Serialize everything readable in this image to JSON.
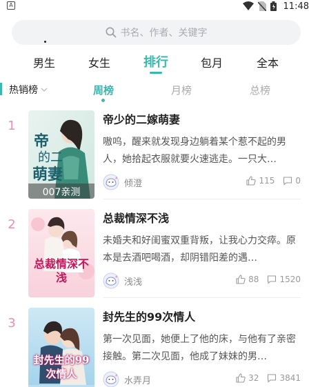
{
  "status": {
    "time": "11:48",
    "app_letter": "A"
  },
  "search": {
    "placeholder": "书名、作者、关键字"
  },
  "top_tabs": [
    {
      "label": "男生"
    },
    {
      "label": "女生"
    },
    {
      "label": "排行"
    },
    {
      "label": "包月"
    },
    {
      "label": "全本"
    }
  ],
  "active_top_tab": "排行",
  "sub": {
    "filter_label": "热销榜",
    "tabs": [
      {
        "label": "周榜"
      },
      {
        "label": "月榜"
      },
      {
        "label": "总榜"
      }
    ]
  },
  "accent_color": "#38b8ae",
  "rank_color": "#e88fb2",
  "books": [
    {
      "rank": "1",
      "title": "帝少的二嫁萌妻",
      "desc": "嗷呜，醒来就发现身边躺着某个惹不起的男人，她拾起衣服就要火速逃走。一只大…",
      "author": "倾澄",
      "likes": "115",
      "comments": "0",
      "cover_text": "007亲测"
    },
    {
      "rank": "2",
      "title": "总裁情深不浅",
      "desc": "未婚夫和好闺蜜双重背叛，让我心力交瘁。原本是去酒吧喝酒，却阴错阳差的遇…",
      "author": "浅浅",
      "likes": "88",
      "comments": "1520",
      "cover_text": "总裁情深不浅"
    },
    {
      "rank": "3",
      "title": "封先生的99次情人",
      "desc": "第一次见面，她便上了他的床，与他有了亲密接触。第二次见面，他成了妹妹的男…",
      "author": "水弄月",
      "likes": "32",
      "comments": "3841",
      "cover_text": "封先生的99次情人"
    }
  ]
}
